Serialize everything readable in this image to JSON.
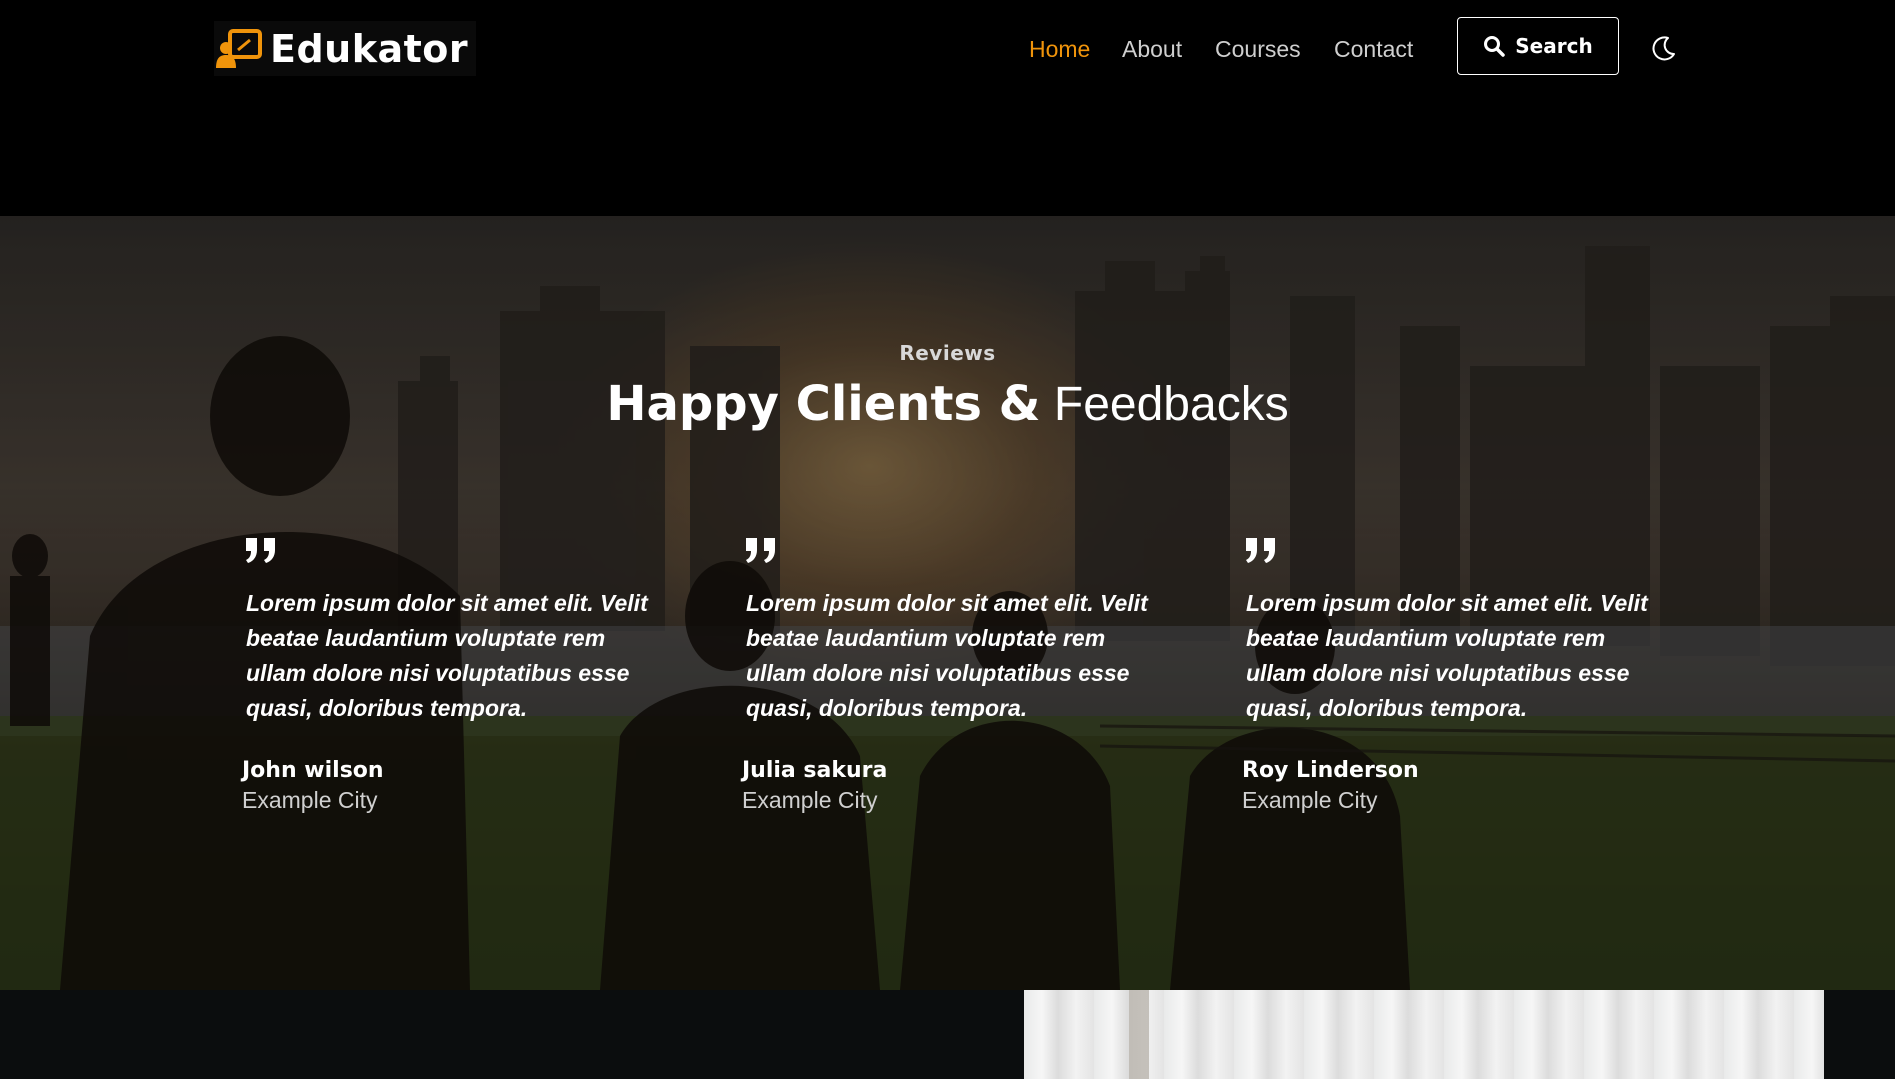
{
  "header": {
    "logo_text": "Edukator",
    "nav": [
      {
        "label": "Home",
        "active": true
      },
      {
        "label": "About",
        "active": false
      },
      {
        "label": "Courses",
        "active": false
      },
      {
        "label": "Contact",
        "active": false
      }
    ],
    "search_label": "Search"
  },
  "reviews": {
    "eyebrow": "Reviews",
    "heading_bold": "Happy Clients &",
    "heading_light": "Feedbacks",
    "items": [
      {
        "text": "Lorem ipsum dolor sit amet elit. Velit beatae laudantium voluptate rem ullam dolore nisi voluptatibus esse quasi, doloribus tempora.",
        "name": "John wilson",
        "city": "Example City"
      },
      {
        "text": "Lorem ipsum dolor sit amet elit. Velit beatae laudantium voluptate rem ullam dolore nisi voluptatibus esse quasi, doloribus tempora.",
        "name": "Julia sakura",
        "city": "Example City"
      },
      {
        "text": "Lorem ipsum dolor sit amet elit. Velit beatae laudantium voluptate rem ullam dolore nisi voluptatibus esse quasi, doloribus tempora.",
        "name": "Roy Linderson",
        "city": "Example City"
      }
    ]
  },
  "colors": {
    "accent": "#f0940b",
    "background": "#000000",
    "nav_text": "#cfcfcf"
  },
  "icons": [
    "teacher-board-logo-icon",
    "search-icon",
    "moon-icon",
    "quote-icon"
  ]
}
